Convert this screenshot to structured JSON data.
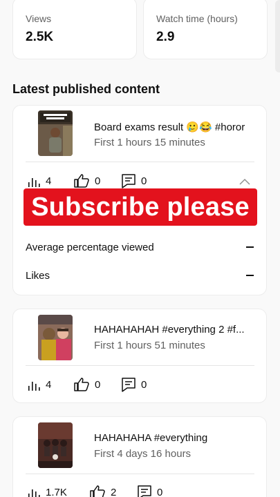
{
  "stats": {
    "views": {
      "label": "Views",
      "value": "2.5K"
    },
    "watch_time": {
      "label": "Watch time (hours)",
      "value": "2.9"
    }
  },
  "section_title": "Latest published content",
  "videos": [
    {
      "title": "Board exams result 🥲😂 #horor",
      "subtitle": "First 1 hours 15 minutes",
      "thumb_caption": "Waiting For Board Exam Result 😭",
      "views": "4",
      "likes": "0",
      "comments": "0",
      "expanded": true,
      "details": [
        {
          "label": "Average percentage viewed",
          "value": "—"
        },
        {
          "label": "Likes",
          "value": "—"
        }
      ]
    },
    {
      "title": "HAHAHAHAH #everything 2 #f...",
      "subtitle": "First 1 hours 51 minutes",
      "views": "4",
      "likes": "0",
      "comments": "0"
    },
    {
      "title": "HAHAHAHA #everything",
      "subtitle": "First 4 days 16 hours",
      "views": "1.7K",
      "likes": "2",
      "comments": "0"
    }
  ],
  "overlay_banner": "Subscribe please",
  "colors": {
    "banner": "#e3121d",
    "muted_text": "#606060",
    "card_bg": "#ffffff"
  },
  "icons": [
    "views-bars-icon",
    "thumbs-up-icon",
    "comment-icon",
    "chevron-up-icon"
  ]
}
